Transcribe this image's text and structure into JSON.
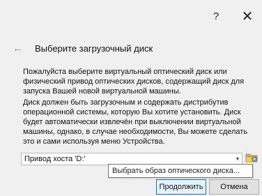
{
  "window": {
    "help_glyph": "?",
    "close_glyph": "✕"
  },
  "header": {
    "back_icon": "back-arrow-icon",
    "title": "Выберите загрузочный диск"
  },
  "description": {
    "paragraph1": "Пожалуйста выберите виртуальный оптический диск или физический привод оптических дисков, содержащий диск для запуска Вашей новой виртуальной машины.",
    "paragraph2": "Диск должен быть загрузочным и содержать дистрибутив операционной системы, которую Вы хотите установить. Диск будет автоматически извлечён при выключении виртуальной машины, однако, в случае необходимости, Вы можете сделать это и сами используя меню Устройства."
  },
  "disk_selector": {
    "value": "Привод хоста 'D:'",
    "arrow_icon": "dropdown-arrow-icon"
  },
  "choose_image": {
    "icon": "folder-disk-icon",
    "tooltip": "Выбрать образ оптического диска..."
  },
  "buttons": {
    "continue_label": "Продолжить",
    "cancel_label": "Отмена"
  },
  "colors": {
    "background": "#f0f0f0",
    "primary_button_border": "#0078d7",
    "folder_icon": "#e8b430"
  }
}
